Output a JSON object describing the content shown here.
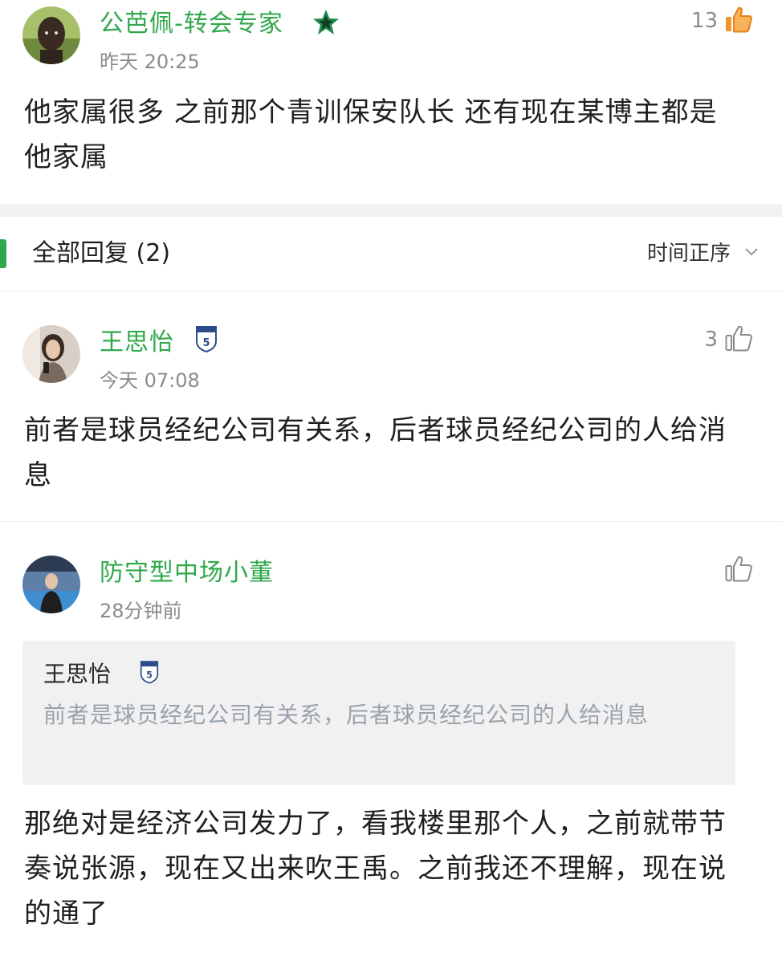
{
  "main_comment": {
    "username": "公芭佩-转会专家",
    "time": "昨天 20:25",
    "likes": "13",
    "text": "他家属很多 之前那个青训保安队长 还有现在某博主都是他家属",
    "badge_icon": "green-star-icon",
    "like_icon": "thumbs-up-filled-icon",
    "like_color": "#f0952e"
  },
  "replies_section": {
    "title": "全部回复 (2)",
    "sort_label": "时间正序",
    "accent": "#2fa84a"
  },
  "replies": [
    {
      "username": "王思怡",
      "time": "今天 07:08",
      "likes": "3",
      "text": "前者是球员经纪公司有关系，后者球员经纪公司的人给消息",
      "badge_icon": "team-crest-icon"
    },
    {
      "username": "防守型中场小董",
      "time": "28分钟前",
      "likes": "",
      "quote": {
        "username": "王思怡",
        "text": "前者是球员经纪公司有关系，后者球员经纪公司的人给消息"
      },
      "text": "那绝对是经济公司发力了，看我楼里那个人，之前就带节奏说张源，现在又出来吹王禹。之前我还不理解，现在说的通了"
    }
  ],
  "colors": {
    "username": "#2fa84a",
    "meta": "#8b8b8b",
    "quote_text": "#9aa3ac",
    "quote_bg": "#f1f1f1"
  }
}
